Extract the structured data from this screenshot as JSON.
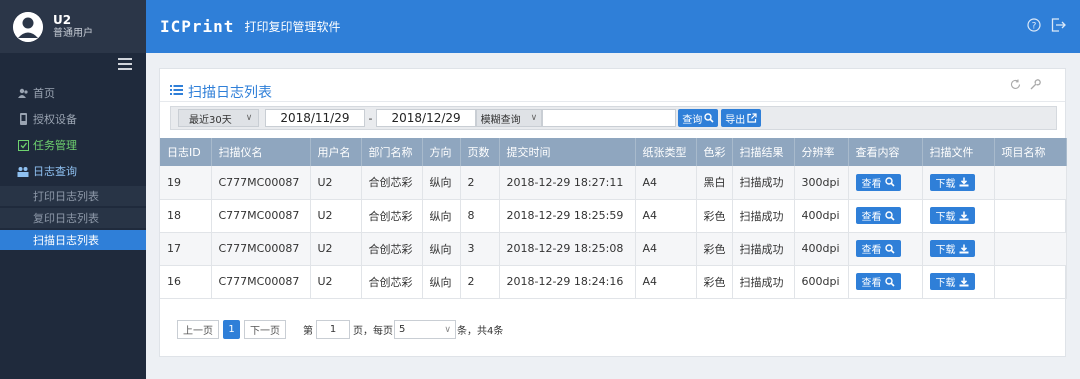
{
  "user": {
    "name": "U2",
    "role": "普通用户"
  },
  "header": {
    "brand": "ICPrint",
    "subtitle": "打印复印管理软件"
  },
  "nav": {
    "items": [
      {
        "label": "首页",
        "icon": "users-icon"
      },
      {
        "label": "授权设备",
        "icon": "device-icon"
      },
      {
        "label": "任务管理",
        "icon": "task-icon"
      },
      {
        "label": "日志查询",
        "icon": "log-icon"
      }
    ],
    "sub_items": [
      {
        "label": "打印日志列表"
      },
      {
        "label": "复印日志列表"
      },
      {
        "label": "扫描日志列表"
      }
    ]
  },
  "panel": {
    "title": "扫描日志列表"
  },
  "toolbar": {
    "range_label": "最近30天",
    "date_from": "2018/11/29",
    "date_to": "2018/12/29",
    "separator": "-",
    "fuzzy_label": "模糊查询",
    "search_value": "",
    "query_label": "查询",
    "export_label": "导出"
  },
  "table": {
    "headers": [
      "日志ID",
      "扫描仪名",
      "用户名",
      "部门名称",
      "方向",
      "页数",
      "提交时间",
      "纸张类型",
      "色彩",
      "扫描结果",
      "分辨率",
      "查看内容",
      "扫描文件",
      "项目名称"
    ],
    "rows": [
      [
        "19",
        "C777MC00087",
        "U2",
        "合创芯彩",
        "纵向",
        "2",
        "2018-12-29 18:27:11",
        "A4",
        "黑白",
        "扫描成功",
        "300dpi",
        "查看",
        "下载",
        ""
      ],
      [
        "18",
        "C777MC00087",
        "U2",
        "合创芯彩",
        "纵向",
        "8",
        "2018-12-29 18:25:59",
        "A4",
        "彩色",
        "扫描成功",
        "400dpi",
        "查看",
        "下载",
        ""
      ],
      [
        "17",
        "C777MC00087",
        "U2",
        "合创芯彩",
        "纵向",
        "3",
        "2018-12-29 18:25:08",
        "A4",
        "彩色",
        "扫描成功",
        "400dpi",
        "查看",
        "下载",
        ""
      ],
      [
        "16",
        "C777MC00087",
        "U2",
        "合创芯彩",
        "纵向",
        "2",
        "2018-12-29 18:24:16",
        "A4",
        "彩色",
        "扫描成功",
        "600dpi",
        "查看",
        "下载",
        ""
      ]
    ]
  },
  "pager": {
    "prev_label": "上一页",
    "current_page": "1",
    "next_label": "下一页",
    "goto_prefix": "第",
    "goto_value": "1",
    "page_size_prefix": "页，每页",
    "page_size": "5",
    "summary": "条，共4条"
  },
  "colors": {
    "accent": "#2f7fd8",
    "sidebar": "#1f2a3c",
    "table_header": "#8fa6bf"
  }
}
